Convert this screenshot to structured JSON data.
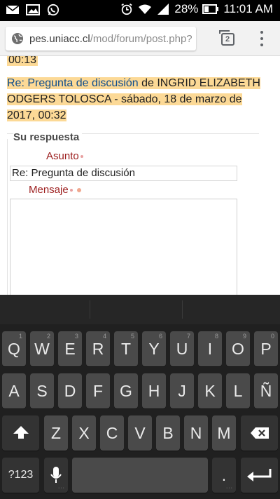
{
  "status_bar": {
    "battery_percent": "28%",
    "time": "11:01 AM",
    "icons": [
      "mail-icon",
      "image-icon",
      "whatsapp-icon",
      "alarm-icon",
      "wifi-icon",
      "signal-icon",
      "battery-icon"
    ]
  },
  "browser": {
    "url_host": "pes.uniacc.cl",
    "url_path": "/mod/forum/post.php?",
    "tab_count": "2"
  },
  "page": {
    "prev_tail": "00:13",
    "post_link": "Re: Pregunta de discusión",
    "post_rest": " de INGRID ELIZABETH ODGERS TOLOSCA - sábado, 18 de marzo de 2017, 00:32",
    "section_legend": "Su respuesta",
    "subject_label": "Asunto",
    "subject_value": "Re: Pregunta de discusión",
    "message_label": "Mensaje",
    "highlight_color": "#fcd996",
    "required_label_color": "#9b1c1c"
  },
  "keyboard": {
    "row1": [
      {
        "label": "Q",
        "num": "1"
      },
      {
        "label": "W",
        "num": "2"
      },
      {
        "label": "E",
        "num": "3"
      },
      {
        "label": "R",
        "num": "4"
      },
      {
        "label": "T",
        "num": "5"
      },
      {
        "label": "Y",
        "num": "6"
      },
      {
        "label": "U",
        "num": "7"
      },
      {
        "label": "I",
        "num": "8"
      },
      {
        "label": "O",
        "num": "9"
      },
      {
        "label": "P",
        "num": "0"
      }
    ],
    "row2": [
      "A",
      "S",
      "D",
      "F",
      "G",
      "H",
      "J",
      "K",
      "L",
      "Ñ"
    ],
    "row3": [
      "Z",
      "X",
      "C",
      "V",
      "B",
      "N",
      "M"
    ],
    "symbols_label": "?123",
    "period_label": "."
  }
}
